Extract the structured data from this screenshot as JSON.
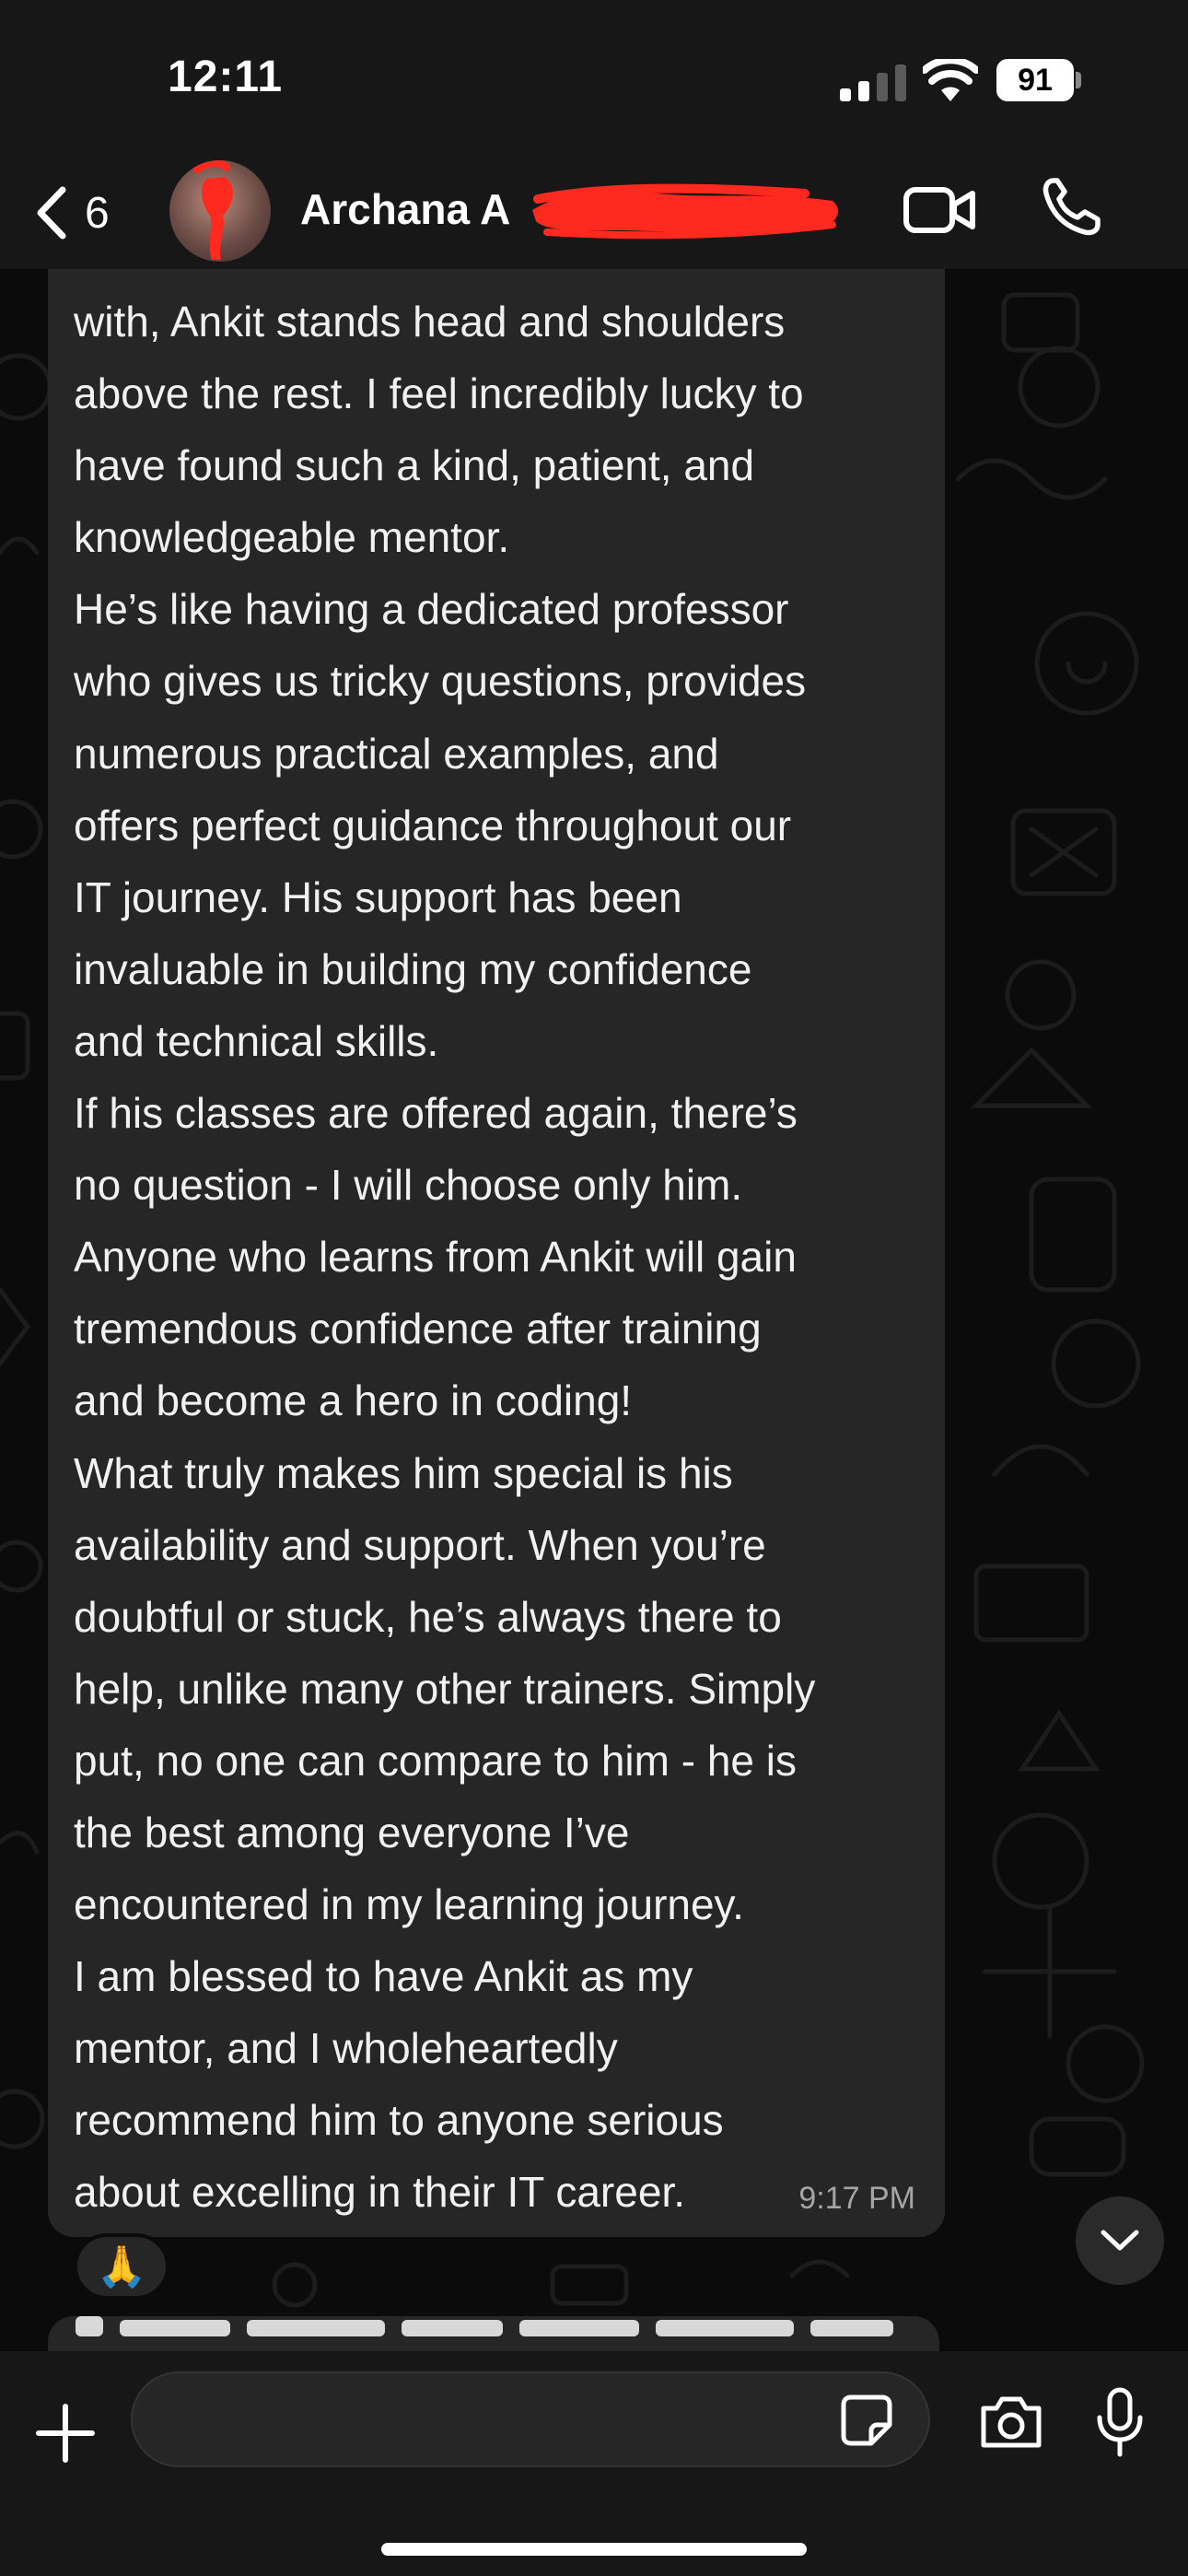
{
  "status_bar": {
    "time": "12:11",
    "battery": "91"
  },
  "header": {
    "back_count": "6",
    "contact_name": "Archana A"
  },
  "message": {
    "text": "with, Ankit stands head and shoulders\nabove the rest. I feel incredibly lucky to\nhave found such a kind, patient, and\nknowledgeable mentor.\nHe’s like having a dedicated professor\nwho gives us tricky questions, provides\nnumerous practical examples, and\noffers perfect guidance throughout our\nIT journey. His support has been\ninvaluable in building my confidence\nand technical skills.\nIf his classes are offered again, there’s\nno question - I will choose only him.\nAnyone who learns from Ankit will gain\ntremendous confidence after training\nand become a hero in coding!\nWhat truly makes him special is his\navailability and support. When you’re\ndoubtful or stuck, he’s always there to\nhelp, unlike many other trainers. Simply\nput, no one can compare to him - he is\nthe best among everyone I’ve\nencountered in my learning journey.\nI am blessed to have Ankit as my\nmentor, and I wholeheartedly\nrecommend him to anyone serious\nabout excelling in their IT career.",
    "time": "9:17 PM",
    "reaction": "🙏"
  },
  "input": {
    "value": "",
    "placeholder": ""
  },
  "icons": {
    "back": "chevron-left-icon",
    "video": "video-camera-icon",
    "call": "phone-icon",
    "plus": "plus-icon",
    "sticker": "sticker-icon",
    "camera": "camera-icon",
    "mic": "microphone-icon",
    "scroll": "chevron-down-icon"
  },
  "colors": {
    "header_bg": "#171717",
    "bubble_bg": "#262626",
    "chat_bg": "#0b0b0b",
    "redaction": "#ff2a1f"
  }
}
